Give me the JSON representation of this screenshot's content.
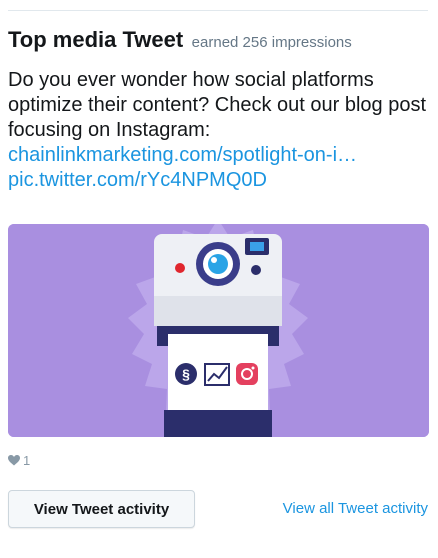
{
  "card": {
    "title": "Top media Tweet",
    "earned": "earned 256 impressions",
    "text": "Do you ever wonder how social platforms optimize their content? Check out our blog post focusing on Instagram:",
    "link1": "chainlinkmarketing.com/spotlight-on-i…",
    "link2": "pic.twitter.com/rYc4NPMQ0D",
    "likes_count": "1",
    "view_activity_label": "View Tweet activity",
    "view_all_label": "View all Tweet activity"
  },
  "colors": {
    "link": "#1b95e0",
    "media_bg": "#a98fe0",
    "text": "#14171a",
    "muted": "#657786"
  },
  "icons": {
    "like": "heart-icon",
    "media_subject": "polaroid-camera-illustration"
  }
}
